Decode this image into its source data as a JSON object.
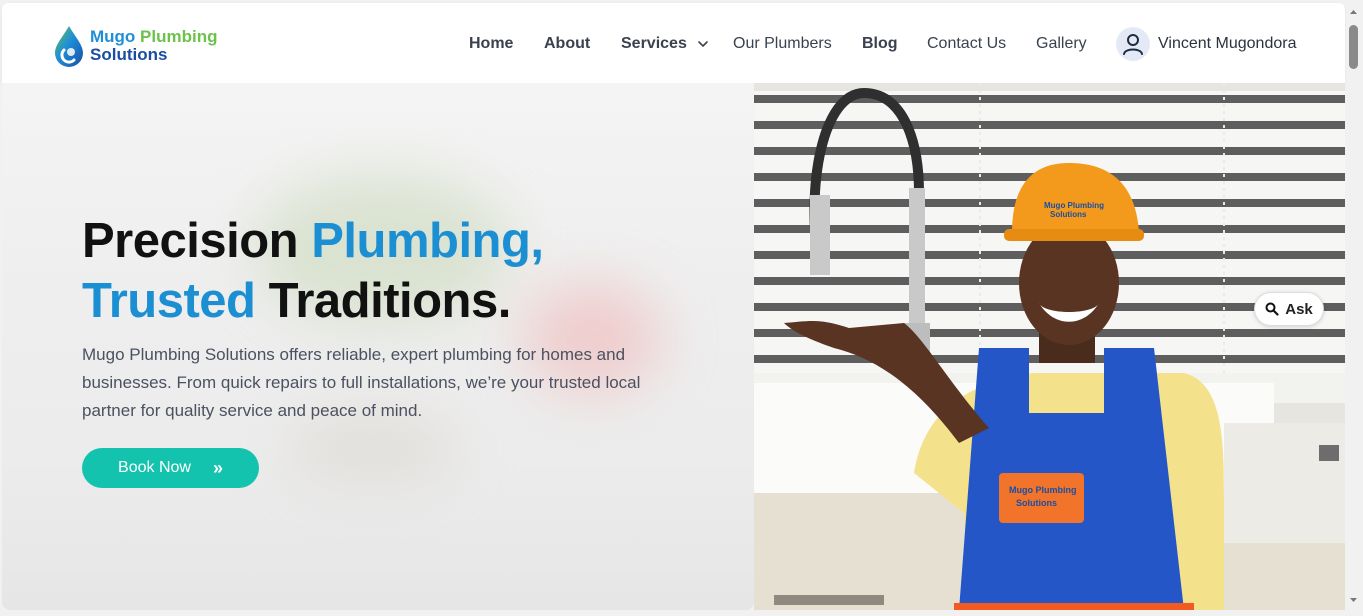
{
  "brand": {
    "name_line1_part1": "Mugo ",
    "name_line1_part2": "Plumbing",
    "name_line2": "Solutions",
    "colors": {
      "blue": "#1f8fd8",
      "green": "#6cc24a",
      "navy": "#1b4ea3"
    }
  },
  "nav": {
    "home": "Home",
    "about": "About",
    "services": "Services",
    "plumbers": "Our Plumbers",
    "blog": "Blog",
    "contact": "Contact Us",
    "gallery": "Gallery"
  },
  "user": {
    "name": "Vincent Mugondora",
    "icon": "user-icon"
  },
  "hero": {
    "headline_part1": "Precision ",
    "headline_part2": "Plumbing,",
    "headline_part3": "Trusted",
    "headline_part4": " Traditions.",
    "description": "Mugo Plumbing Solutions offers reliable, expert plumbing for homes and businesses. From quick repairs to full installations, we’re your trusted local partner for quality service and peace of mind.",
    "cta_label": "Book Now",
    "cta_icon": "double-chevron-right-icon",
    "accent_color": "#1c8fd2",
    "cta_color": "#14c3ad",
    "hat_text_line1": "Mugo Plumbing",
    "hat_text_line2": "Solutions",
    "bib_text_line1": "Mugo Plumbing",
    "bib_text_line2": "Solutions"
  },
  "ask": {
    "label": "Ask",
    "icon": "search-icon"
  }
}
